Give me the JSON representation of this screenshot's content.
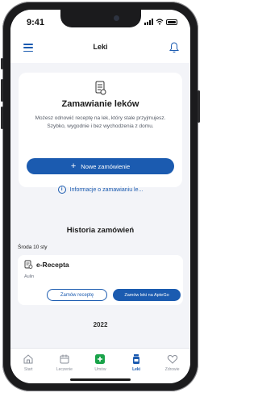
{
  "status": {
    "time": "9:41"
  },
  "header": {
    "title": "Leki"
  },
  "order_card": {
    "title": "Zamawianie leków",
    "description": "Możesz odnowić receptę na lek, który stale przyjmujesz. Szybko, wygodnie i bez wychodzenia z domu.",
    "primary_button": "Nowe zamówienie",
    "info_link": "Informacje o zamawianiu le..."
  },
  "history": {
    "title": "Historia zamówień",
    "date": "Środa 10 sty",
    "prescription": {
      "title": "e-Recepta",
      "subtitle": "Aulin",
      "button_reorder": "Zamów receptę",
      "button_apteka": "Zamów leki na ApteGo"
    },
    "year": "2022"
  },
  "tabs": [
    {
      "label": "Start",
      "icon": "home-icon"
    },
    {
      "label": "Leczenie",
      "icon": "calendar-icon"
    },
    {
      "label": "Umów",
      "icon": "plus-square-icon"
    },
    {
      "label": "Leki",
      "icon": "medicine-icon",
      "active": true
    },
    {
      "label": "Zdrowie",
      "icon": "heart-icon"
    }
  ],
  "colors": {
    "accent": "#1b5bb0",
    "background": "#f3f4f8",
    "card": "#ffffff",
    "green": "#1aa34a"
  }
}
